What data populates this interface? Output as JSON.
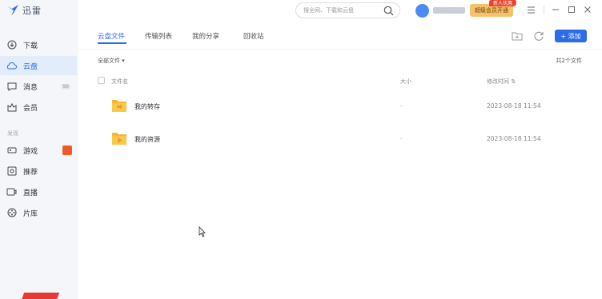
{
  "app": {
    "title": "迅雷"
  },
  "sidebar": {
    "items": [
      {
        "label": "下载",
        "icon": "download-icon"
      },
      {
        "label": "云盘",
        "icon": "cloud-icon"
      },
      {
        "label": "消息",
        "icon": "message-icon",
        "badge": "99"
      },
      {
        "label": "会员",
        "icon": "crown-icon"
      }
    ],
    "section_label": "发现",
    "discover_items": [
      {
        "label": "游戏",
        "icon": "gamepad-icon"
      },
      {
        "label": "推荐",
        "icon": "recommend-icon"
      },
      {
        "label": "直播",
        "icon": "live-icon"
      },
      {
        "label": "片库",
        "icon": "film-icon"
      }
    ]
  },
  "header": {
    "search_placeholder": "搜全网、下载和云盘",
    "vip_button": "超级会员开通",
    "vip_tag": "新人优惠"
  },
  "tabs": [
    {
      "label": "云盘文件"
    },
    {
      "label": "传输列表"
    },
    {
      "label": "我的分享"
    },
    {
      "label": "回收站"
    }
  ],
  "toolbar": {
    "add_label": "+ 添加"
  },
  "filter": {
    "label": "全部文件 ▾"
  },
  "file_count": "共2个文件",
  "table": {
    "columns": [
      "文件名",
      "大小",
      "修改时间 ⇅"
    ],
    "rows": [
      {
        "name": "我的转存",
        "size": "-",
        "modified": "2023-08-18 11:54"
      },
      {
        "name": "我的资源",
        "size": "-",
        "modified": "2023-08-18 11:54"
      }
    ]
  },
  "colors": {
    "accent": "#2b6ce8",
    "folder": "#f7b733",
    "vip": "#f5c26b",
    "hot": "#f05a28"
  }
}
